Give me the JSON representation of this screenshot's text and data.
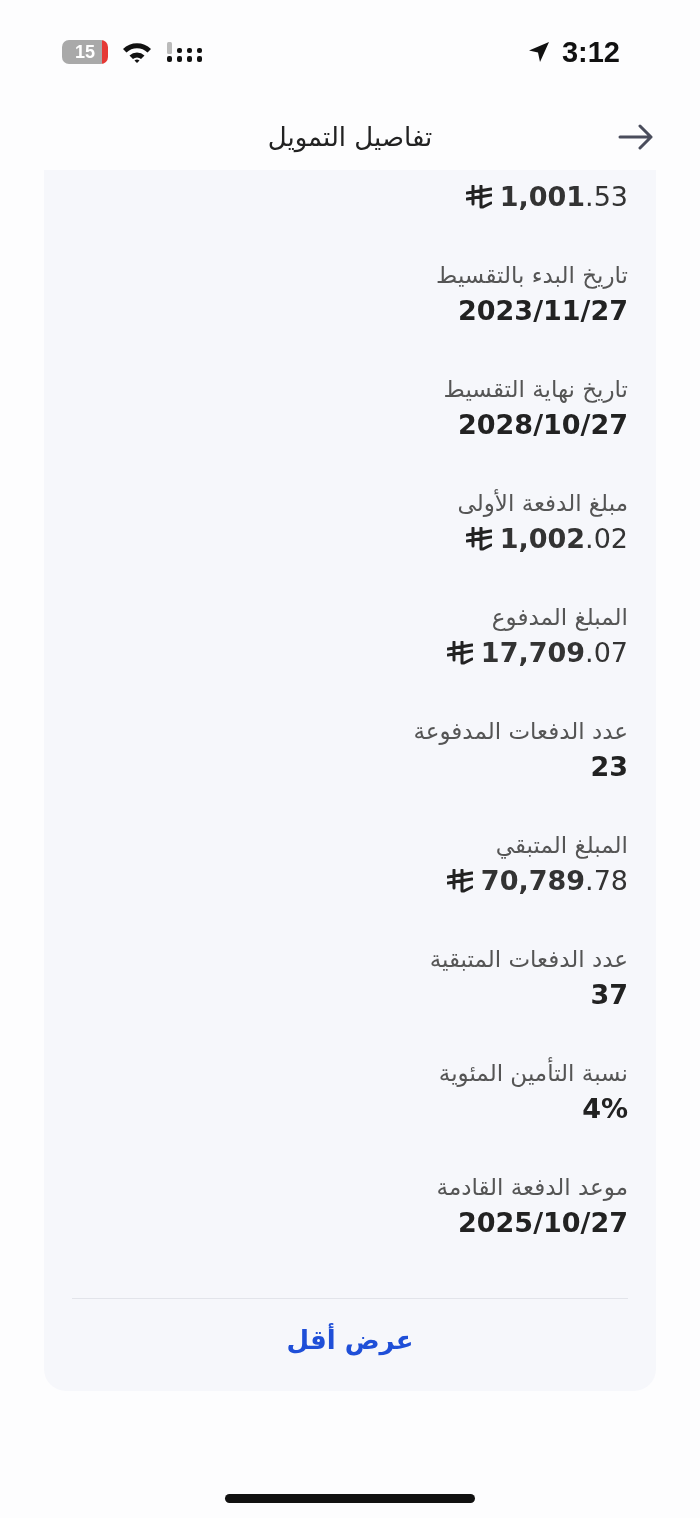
{
  "status_bar": {
    "battery": "15",
    "time": "3:12"
  },
  "header": {
    "title": "تفاصيل التمويل"
  },
  "details": [
    {
      "kind": "amount",
      "value": "**1,001**.53"
    },
    {
      "kind": "plain",
      "label": "تاريخ البدء بالتقسيط",
      "value": "2023/11/27"
    },
    {
      "kind": "plain",
      "label": "تاريخ نهاية التقسيط",
      "value": "2028/10/27"
    },
    {
      "kind": "amount",
      "label": "مبلغ الدفعة الأولى",
      "value": "**1,002**.02"
    },
    {
      "kind": "amount",
      "label": "المبلغ المدفوع",
      "value": "**17,709**.07"
    },
    {
      "kind": "plain",
      "label": "عدد الدفعات المدفوعة",
      "value": "23"
    },
    {
      "kind": "amount",
      "label": "المبلغ المتبقي",
      "value": "**70,789**.78"
    },
    {
      "kind": "plain",
      "label": "عدد الدفعات المتبقية",
      "value": "37"
    },
    {
      "kind": "plain",
      "label": "نسبة التأمين المئوية",
      "value": "4%"
    },
    {
      "kind": "plain",
      "label": "موعد الدفعة القادمة",
      "value": "2025/10/27"
    }
  ],
  "show_less_button": "عرض أقل"
}
